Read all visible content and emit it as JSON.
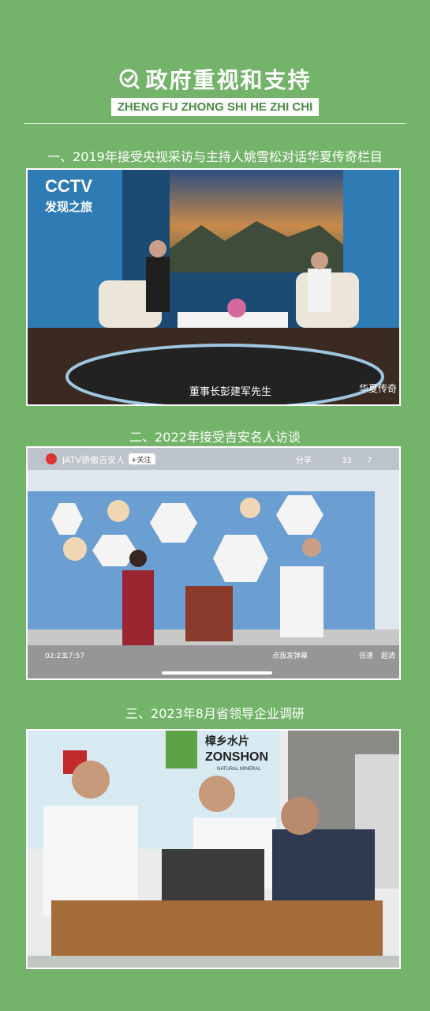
{
  "header": {
    "title": "政府重视和支持",
    "subtitle": "ZHENG FU ZHONG SHI HE ZHI CHI"
  },
  "sections": [
    {
      "title": "一、2019年接受央视采访与主持人姚雪松对话华夏传奇栏目",
      "photo": {
        "logo": "CCTV",
        "channel": "发现之旅",
        "caption": "董事长彭建军先生",
        "watermark": "华夏传奇"
      }
    },
    {
      "title": "二、2022年接受吉安名人访谈",
      "photo": {
        "account": "JATV骄傲吉安人",
        "follow": "+关注",
        "share": "分享",
        "likes": "33",
        "coins": "7",
        "time": "02:23",
        "duration": "17:57",
        "danmaku": "点我发弹幕",
        "speed": "倍速",
        "quality": "超清"
      }
    },
    {
      "title": "三、2023年8月省领导企业调研",
      "photo": {
        "brand_cn": "樟乡水片",
        "brand_en": "ZONSHON",
        "brand_sub": "NATURAL MINERAL"
      }
    }
  ]
}
